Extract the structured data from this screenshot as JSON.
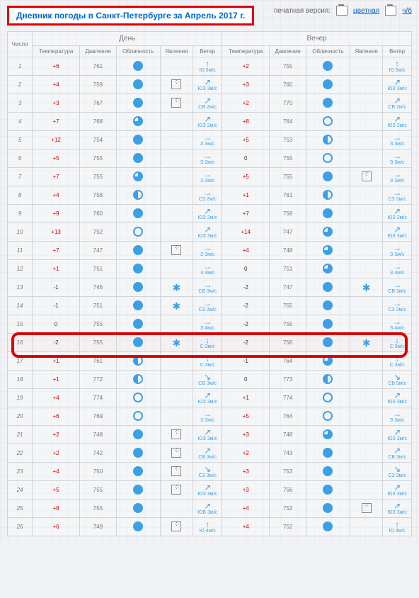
{
  "title": "Дневник погоды в Санкт-Петербурге за Апрель 2017 г.",
  "print": {
    "label": "печатная версия:",
    "color": "цветная",
    "bw": "ч/б"
  },
  "headers": {
    "num": "Число",
    "day": "День",
    "evening": "Вечер",
    "temp": "Температура",
    "press": "Давление",
    "cloud": "Облачность",
    "phen": "Явления",
    "wind": "Ветер"
  },
  "rows": [
    {
      "n": 1,
      "dt": "+6",
      "dp": 761,
      "dc": "full",
      "dph": "",
      "dw": "↑",
      "dwl": "Ю 5м/с",
      "et": "+2",
      "ep": 755,
      "ec": "full",
      "eph": "",
      "ew": "↑",
      "ewl": "Ю 5м/с"
    },
    {
      "n": 2,
      "dt": "+4",
      "dp": 759,
      "dc": "full",
      "dph": "dice",
      "dw": "↗",
      "dwl": "ЮЗ 3м/с",
      "et": "+3",
      "ep": 760,
      "ec": "full",
      "eph": "",
      "ew": "↗",
      "ewl": "ЮЗ 3м/с"
    },
    {
      "n": 3,
      "dt": "+3",
      "dp": 767,
      "dc": "full",
      "dph": "dice",
      "dw": "↗",
      "dwl": "СВ 2м/с",
      "et": "+2",
      "ep": 770,
      "ec": "full",
      "eph": "",
      "ew": "↗",
      "ewl": "СВ 2м/с"
    },
    {
      "n": 4,
      "dt": "+7",
      "dp": 768,
      "dc": "q3",
      "dph": "",
      "dw": "↗",
      "dwl": "ЮЗ 2м/с",
      "et": "+8",
      "ep": 764,
      "ec": "empty",
      "eph": "",
      "ew": "↗",
      "ewl": "ЮЗ 2м/с"
    },
    {
      "n": 5,
      "dt": "+12",
      "dp": 754,
      "dc": "full",
      "dph": "",
      "dw": "→",
      "dwl": "З 3м/с",
      "et": "+5",
      "ep": 753,
      "ec": "half",
      "eph": "",
      "ew": "→",
      "ewl": "З 3м/с"
    },
    {
      "n": 6,
      "dt": "+5",
      "dp": 755,
      "dc": "full",
      "dph": "",
      "dw": "→",
      "dwl": "З 2м/с",
      "et": "0",
      "ep": 755,
      "ec": "empty",
      "eph": "",
      "ew": "→",
      "ewl": "З 3м/с"
    },
    {
      "n": 7,
      "dt": "+7",
      "dp": 755,
      "dc": "q3",
      "dph": "",
      "dw": "→",
      "dwl": "З 2м/с",
      "et": "+5",
      "ep": 755,
      "ec": "full",
      "eph": "dice",
      "ew": "→",
      "ewl": "З 3м/с"
    },
    {
      "n": 8,
      "dt": "+4",
      "dp": 758,
      "dc": "half",
      "dph": "",
      "dw": "→",
      "dwl": "СЗ 2м/с",
      "et": "+1",
      "ep": 761,
      "ec": "half",
      "eph": "",
      "ew": "→",
      "ewl": "СЗ 2м/с"
    },
    {
      "n": 9,
      "dt": "+9",
      "dp": 760,
      "dc": "full",
      "dph": "",
      "dw": "↗",
      "dwl": "ЮЗ 2м/с",
      "et": "+7",
      "ep": 758,
      "ec": "full",
      "eph": "",
      "ew": "↗",
      "ewl": "ЮЗ 2м/с"
    },
    {
      "n": 10,
      "dt": "+13",
      "dp": 752,
      "dc": "empty",
      "dph": "",
      "dw": "↗",
      "dwl": "ЮЗ 3м/с",
      "et": "+14",
      "ep": 747,
      "ec": "q3",
      "eph": "",
      "ew": "↗",
      "ewl": "ЮЗ 3м/с"
    },
    {
      "n": 11,
      "dt": "+7",
      "dp": 747,
      "dc": "full",
      "dph": "dice",
      "dw": "→",
      "dwl": "З 3м/с",
      "et": "+4",
      "ep": 748,
      "ec": "q3",
      "eph": "",
      "ew": "→",
      "ewl": "З 3м/с"
    },
    {
      "n": 12,
      "dt": "+1",
      "dp": 751,
      "dc": "full",
      "dph": "",
      "dw": "→",
      "dwl": "З 4м/с",
      "et": "0",
      "ep": 751,
      "ec": "q3",
      "eph": "",
      "ew": "→",
      "ewl": "З 4м/с"
    },
    {
      "n": 13,
      "dt": "-1",
      "dp": 746,
      "dc": "full",
      "dph": "snow",
      "dw": "→",
      "dwl": "СВ 3м/с",
      "et": "-2",
      "ep": 747,
      "ec": "full",
      "eph": "snow",
      "ew": "→",
      "ewl": "СВ 3м/с"
    },
    {
      "n": 14,
      "dt": "-1",
      "dp": 751,
      "dc": "full",
      "dph": "snow",
      "dw": "→",
      "dwl": "СЗ 2м/с",
      "et": "-2",
      "ep": 755,
      "ec": "full",
      "eph": "",
      "ew": "→",
      "ewl": "СЗ 2м/с"
    },
    {
      "n": 15,
      "dt": "0",
      "dp": 755,
      "dc": "full",
      "dph": "",
      "dw": "→",
      "dwl": "З 4м/с",
      "et": "-2",
      "ep": 755,
      "ec": "full",
      "eph": "",
      "ew": "→",
      "ewl": "З 4м/с"
    },
    {
      "n": 16,
      "dt": "-2",
      "dp": 755,
      "dc": "full",
      "dph": "snow",
      "dw": "↓",
      "dwl": "С 3м/с",
      "et": "-2",
      "ep": 756,
      "ec": "full",
      "eph": "snow",
      "ew": "↓",
      "ewl": "С 3м/с",
      "hl": true
    },
    {
      "n": 17,
      "dt": "+1",
      "dp": 761,
      "dc": "half",
      "dph": "",
      "dw": "↓",
      "dwl": "С 3м/с",
      "et": "-1",
      "ep": 764,
      "ec": "q3",
      "eph": "",
      "ew": "↓",
      "ewl": "С 3м/с"
    },
    {
      "n": 18,
      "dt": "+1",
      "dp": 772,
      "dc": "half",
      "dph": "",
      "dw": "↘",
      "dwl": "СВ 3м/с",
      "et": "0",
      "ep": 773,
      "ec": "half",
      "eph": "",
      "ew": "↘",
      "ewl": "СВ 5м/с"
    },
    {
      "n": 19,
      "dt": "+4",
      "dp": 774,
      "dc": "empty",
      "dph": "",
      "dw": "↗",
      "dwl": "ЮЗ 3м/с",
      "et": "+1",
      "ep": 774,
      "ec": "empty",
      "eph": "",
      "ew": "↗",
      "ewl": "ЮЗ 3м/с"
    },
    {
      "n": 20,
      "dt": "+6",
      "dp": 769,
      "dc": "empty",
      "dph": "",
      "dw": "→",
      "dwl": "З 2м/с",
      "et": "+5",
      "ep": 764,
      "ec": "empty",
      "eph": "",
      "ew": "→",
      "ewl": "З 3м/с"
    },
    {
      "n": 21,
      "dt": "+2",
      "dp": 748,
      "dc": "full",
      "dph": "dice",
      "dw": "↗",
      "dwl": "ЮЗ 3м/с",
      "et": "+3",
      "ep": 748,
      "ec": "q3",
      "eph": "",
      "ew": "↗",
      "ewl": "ЮЗ 3м/с"
    },
    {
      "n": 22,
      "dt": "+2",
      "dp": 742,
      "dc": "full",
      "dph": "dice",
      "dw": "↗",
      "dwl": "СВ 3м/с",
      "et": "+2",
      "ep": 743,
      "ec": "full",
      "eph": "",
      "ew": "↗",
      "ewl": "СВ 3м/с"
    },
    {
      "n": 23,
      "dt": "+4",
      "dp": 750,
      "dc": "full",
      "dph": "dice",
      "dw": "↘",
      "dwl": "СЗ 3м/с",
      "et": "+3",
      "ep": 753,
      "ec": "full",
      "eph": "",
      "ew": "↘",
      "ewl": "СЗ 3м/с"
    },
    {
      "n": 24,
      "dt": "+5",
      "dp": 755,
      "dc": "full",
      "dph": "dice",
      "dw": "↗",
      "dwl": "ЮЗ 3м/с",
      "et": "+3",
      "ep": 756,
      "ec": "full",
      "eph": "",
      "ew": "↗",
      "ewl": "ЮЗ 3м/с"
    },
    {
      "n": 25,
      "dt": "+8",
      "dp": 755,
      "dc": "full",
      "dph": "",
      "dw": "↗",
      "dwl": "ЮВ 3м/с",
      "et": "+4",
      "ep": 752,
      "ec": "full",
      "eph": "dice",
      "ew": "↗",
      "ewl": "ЮЗ 3м/с"
    },
    {
      "n": 26,
      "dt": "+6",
      "dp": 749,
      "dc": "full",
      "dph": "dice",
      "dw": "↑",
      "dwl": "Ю 4м/с",
      "et": "+4",
      "ep": 752,
      "ec": "full",
      "eph": "",
      "ew": "↑",
      "ewl": "Ю 4м/с"
    }
  ]
}
